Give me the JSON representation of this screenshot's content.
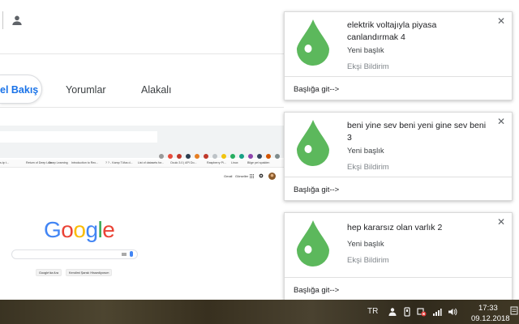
{
  "browser": {
    "tabs": [
      {
        "label": "el Bakış",
        "active": true
      },
      {
        "label": "Yorumlar",
        "active": false
      },
      {
        "label": "Alakalı",
        "active": false
      }
    ],
    "accent_color": "#1a73e8"
  },
  "screenshot_preview": {
    "bookmarks": [
      "s.tp t... ",
      "Return of Deep Lea...",
      "Deep Learning",
      "Introduction to Rec...",
      "? ? - Kamp Tüfus d...",
      "List of datasets for...",
      "Oculo 3.0 | API Do...",
      "Raspberry Pi...",
      "Linux",
      "Bilge pei spalden"
    ],
    "top_right_links": [
      "Gmail",
      "Görseller"
    ],
    "logo": "Google",
    "buttons": [
      "Google'da Ara",
      "Kendimi Şanslı Hissediyorum"
    ]
  },
  "notifications": [
    {
      "title": "elektrik voltajıyla piyasa canlandırmak 4",
      "subtitle": "Yeni başlık",
      "source": "Ekşi Bildirim",
      "action": "Başlığa git-->",
      "close": "✕"
    },
    {
      "title": "beni yine sev beni yeni gine sev beni 3",
      "subtitle": "Yeni başlık",
      "source": "Ekşi Bildirim",
      "action": "Başlığa git-->",
      "close": "✕"
    },
    {
      "title": "hep kararsız olan varlık 2",
      "subtitle": "Yeni başlık",
      "source": "Ekşi Bildirim",
      "action": "Başlığa git-->",
      "close": "✕"
    }
  ],
  "taskbar": {
    "language": "TR",
    "time": "17:33",
    "date": "09.12.2018"
  },
  "colors": {
    "drop_green": "#5cb85c",
    "google_blue": "#4285F4",
    "google_red": "#EA4335",
    "google_yellow": "#FBBC05",
    "google_green": "#34A853"
  }
}
